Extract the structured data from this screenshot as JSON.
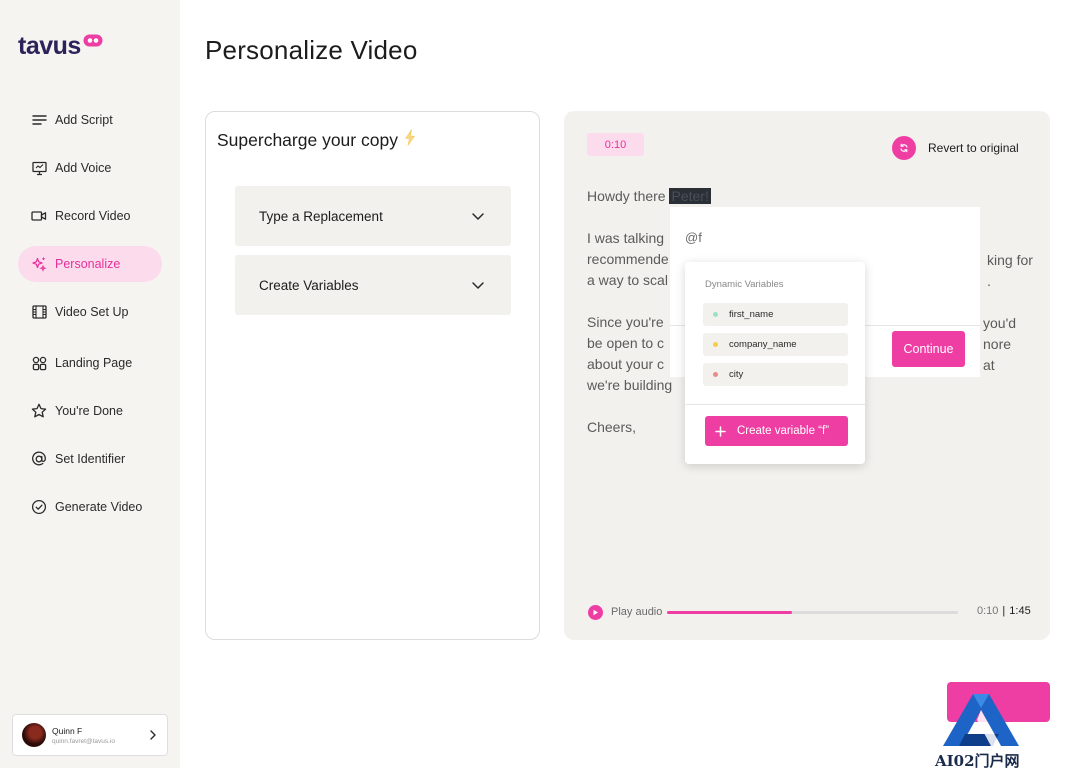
{
  "app": {
    "logo_text": "tavus",
    "brand_color": "#ef3ea3"
  },
  "sidebar": {
    "items": [
      {
        "label": "Add Script",
        "icon": "lines-icon"
      },
      {
        "label": "Add Voice",
        "icon": "presentation-icon"
      },
      {
        "label": "Record Video",
        "icon": "video-camera-icon"
      },
      {
        "label": "Personalize",
        "icon": "sparkles-icon",
        "active": true
      },
      {
        "label": "Video Set Up",
        "icon": "film-icon"
      },
      {
        "label": "Landing Page",
        "icon": "grid-icon"
      },
      {
        "label": "You're Done",
        "icon": "star-icon"
      },
      {
        "label": "Set Identifier",
        "icon": "at-icon"
      },
      {
        "label": "Generate Video",
        "icon": "check-circle-icon"
      }
    ],
    "user": {
      "name": "Quinn F",
      "email": "quinn.favret@tavus.io"
    }
  },
  "page": {
    "title": "Personalize Video"
  },
  "left_panel": {
    "title": "Supercharge your copy",
    "accordions": [
      {
        "label": "Type a Replacement"
      },
      {
        "label": "Create Variables"
      }
    ]
  },
  "right_panel": {
    "time_badge": "0:10",
    "revert_label": "Revert to original",
    "script": {
      "line1_prefix": "Howdy there",
      "line1_highlight": "Peter!",
      "p2_lines": [
        "I was talking",
        "recommende",
        "a way to scal"
      ],
      "p2_right": [
        "",
        "king for",
        "."
      ],
      "p3_lines": [
        "Since you're",
        "be open to c",
        "about your c",
        "we're building"
      ],
      "p3_right": [
        "you'd",
        "nore",
        "at",
        ""
      ],
      "closing": "Cheers,"
    },
    "editor": {
      "typed_value": "@f",
      "continue_label": "Continue"
    },
    "dropdown": {
      "title": "Dynamic Variables",
      "items": [
        {
          "label": "first_name",
          "dot_color": "#9ee0c2"
        },
        {
          "label": "company_name",
          "dot_color": "#f5cf47"
        },
        {
          "label": "city",
          "dot_color": "#ef8a8a"
        }
      ],
      "create_label": "Create variable “f”"
    },
    "audio": {
      "label": "Play audio",
      "current": "0:10",
      "total": "1:45",
      "progress": 0.43
    }
  },
  "watermark": {
    "text": "AI02门户网"
  }
}
